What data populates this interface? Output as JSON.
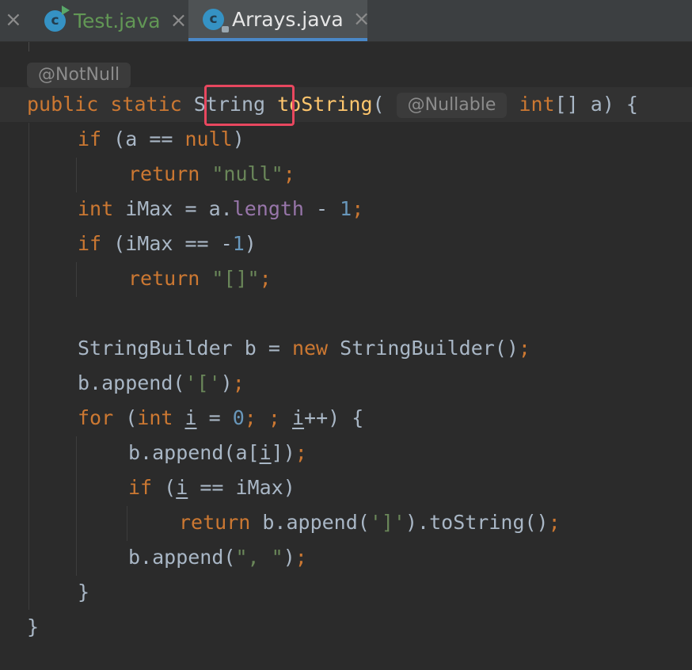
{
  "tabs": [
    {
      "label": "Test.java",
      "close": "×",
      "icon": "c"
    },
    {
      "label": "Arrays.java",
      "close": "×",
      "icon": "c"
    }
  ],
  "tab_overflow_close": "×",
  "hints": {
    "return_annotation": "@NotNull",
    "param_annotation": "@Nullable"
  },
  "code": {
    "sig_public": "public",
    "sig_static": "static",
    "sig_type": "String",
    "sig_method": "toString",
    "sig_paren": "(",
    "sig_int": "int",
    "sig_rest": "[] a) {",
    "l2_if": "if",
    "l2_a": " (a == ",
    "l2_null": "null",
    "l2_end": ")",
    "l3_return": "return",
    "l3_str": "\"null\"",
    "l3_semi": ";",
    "l4_int": "int",
    "l4_a": " iMax = a.",
    "l4_len": "length",
    "l4_b": " - ",
    "l4_num": "1",
    "l4_semi": ";",
    "l5_if": "if",
    "l5_a": " (iMax == -",
    "l5_num": "1",
    "l5_end": ")",
    "l6_return": "return",
    "l6_str": "\"[]\"",
    "l6_semi": ";",
    "l8_a": "StringBuilder b = ",
    "l8_new": "new",
    "l8_b": " StringBuilder()",
    "l8_semi": ";",
    "l9_a": "b.append(",
    "l9_str": "'['",
    "l9_b": ")",
    "l9_semi": ";",
    "l10_for": "for",
    "l10_a": " (",
    "l10_int": "int",
    "l10_sp": " ",
    "l10_i1": "i",
    "l10_eq": " = ",
    "l10_zero": "0",
    "l10_semis": "; ;",
    "l10_sp2": " ",
    "l10_i2": "i",
    "l10_end": "++) {",
    "l11_a": "b.append(a[",
    "l11_i": "i",
    "l11_b": "])",
    "l11_semi": ";",
    "l12_if": "if",
    "l12_a": " (",
    "l12_i": "i",
    "l12_b": " == iMax)",
    "l13_return": "return",
    "l13_a": " b.append(",
    "l13_str": "']'",
    "l13_b": ").toString()",
    "l13_semi": ";",
    "l14_a": "b.append(",
    "l14_str": "\", \"",
    "l14_b": ")",
    "l14_semi": ";",
    "l15": "}",
    "l16": "}"
  },
  "colors": {
    "background": "#2b2b2b",
    "keyword": "#cc7832",
    "string": "#6a8759",
    "number": "#6897bb",
    "field": "#9876aa",
    "method": "#ffc66d",
    "highlight": "#e8475f"
  }
}
